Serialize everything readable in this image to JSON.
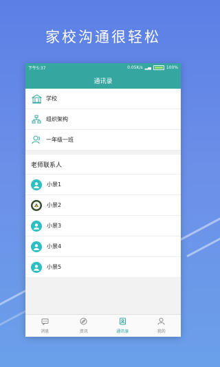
{
  "headline": "家校沟通很轻松",
  "status_bar": {
    "time": "下午5:37",
    "speed": "0.05K/s",
    "battery": "100%"
  },
  "nav": {
    "title": "通讯录"
  },
  "org": [
    {
      "label": "学校",
      "icon": "school-building-icon"
    },
    {
      "label": "组织架构",
      "icon": "org-chart-icon"
    },
    {
      "label": "一年级一班",
      "icon": "class-group-icon"
    }
  ],
  "teachers": {
    "title": "老师联系人",
    "contacts": [
      {
        "name": "小景1",
        "avatar": "default-avatar"
      },
      {
        "name": "小景2",
        "avatar": "photo-avatar"
      },
      {
        "name": "小景3",
        "avatar": "default-avatar"
      },
      {
        "name": "小景4",
        "avatar": "default-avatar"
      },
      {
        "name": "小景5",
        "avatar": "default-avatar"
      }
    ]
  },
  "tabs": [
    {
      "label": "消息",
      "icon": "message-icon"
    },
    {
      "label": "资讯",
      "icon": "compass-icon"
    },
    {
      "label": "通讯录",
      "icon": "contacts-icon",
      "active": true
    },
    {
      "label": "我的",
      "icon": "profile-icon"
    }
  ],
  "colors": {
    "accent": "#35a7a0",
    "avatar": "#2fbfc3"
  }
}
